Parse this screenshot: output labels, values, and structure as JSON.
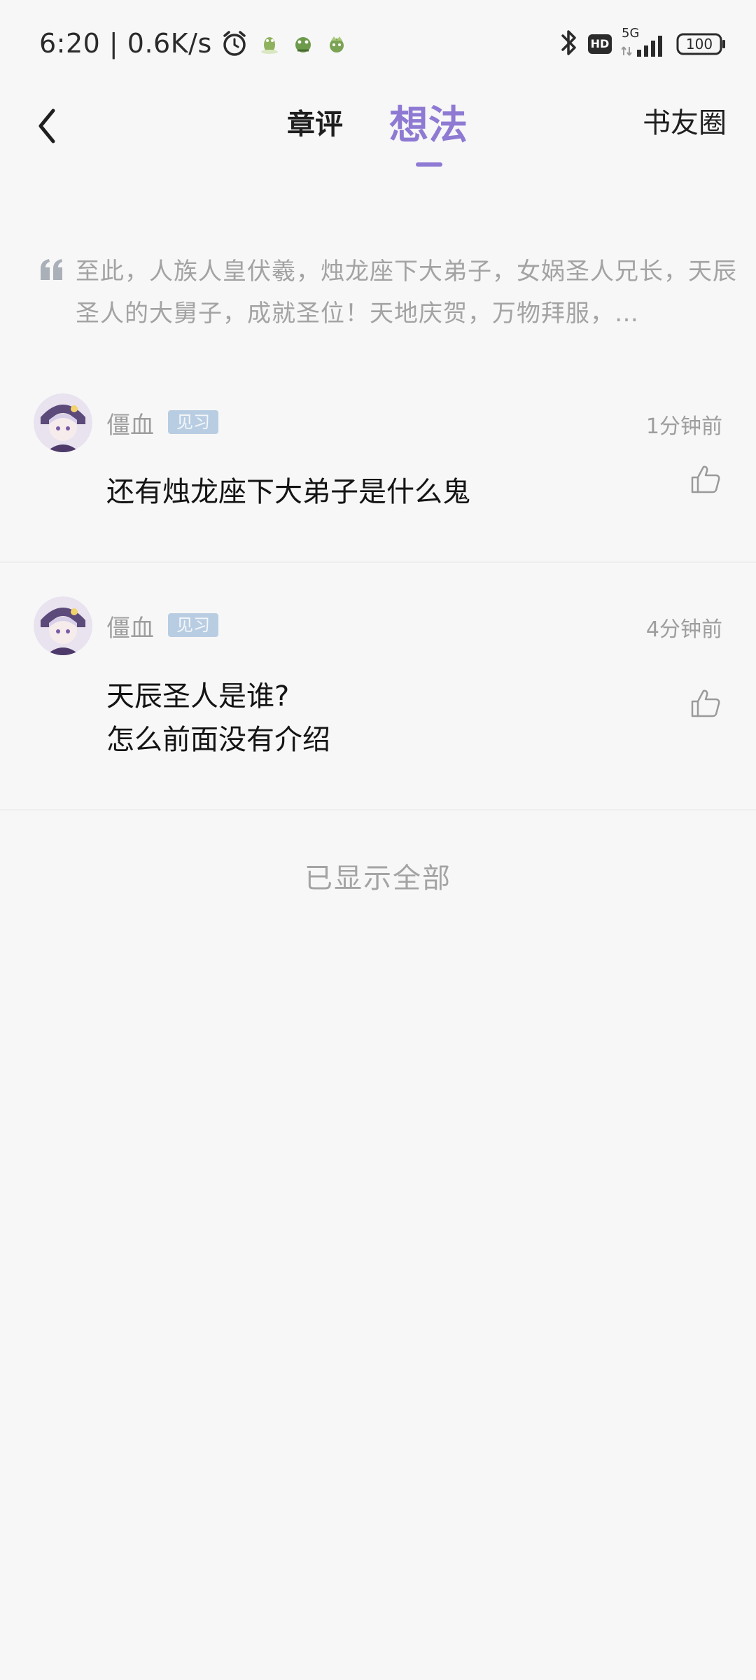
{
  "status_bar": {
    "time_speed": "6:20 | 0.6K/s",
    "network": "5G",
    "hd_badge": "HD",
    "battery": "100",
    "icons": [
      "alarm-icon",
      "app-notification-icon",
      "app-notification-icon",
      "app-notification-icon",
      "bluetooth-icon",
      "signal-icon",
      "battery-icon"
    ]
  },
  "header": {
    "tabs": [
      {
        "label": "章评",
        "active": false
      },
      {
        "label": "想法",
        "active": true
      }
    ],
    "right_link": "书友圈",
    "accent_color": "#8e7ad3"
  },
  "quote": {
    "text": "至此，人族人皇伏羲，烛龙座下大弟子，女娲圣人兄长，天辰圣人的大舅子，成就圣位！天地庆贺，万物拜服，…"
  },
  "comments": [
    {
      "username": "僵血",
      "level": "见习",
      "time": "1分钟前",
      "text": "还有烛龙座下大弟子是什么鬼"
    },
    {
      "username": "僵血",
      "level": "见习",
      "time": "4分钟前",
      "text": "天辰圣人是谁?\n怎么前面没有介绍"
    }
  ],
  "footer": {
    "all_shown": "已显示全部"
  }
}
